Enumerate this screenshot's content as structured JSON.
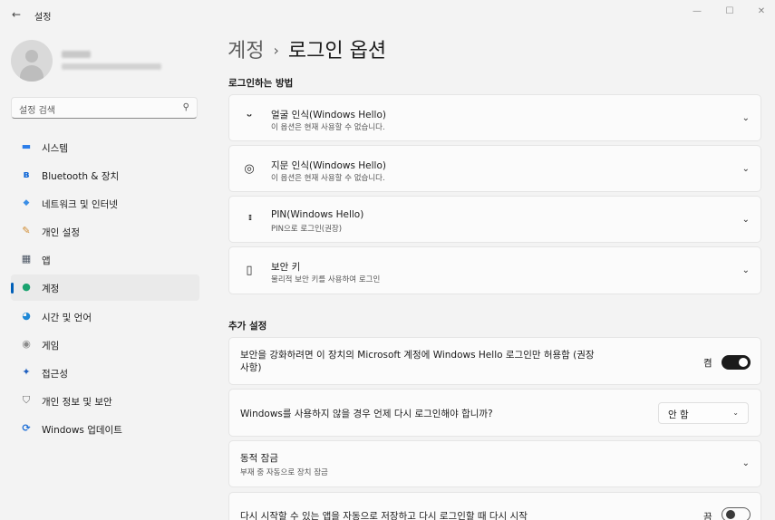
{
  "window": {
    "title": "설정",
    "back_icon": "←",
    "minimize": "—",
    "maximize": "☐",
    "close": "✕"
  },
  "sidebar": {
    "search_placeholder": "설정 검색",
    "search_icon": "⚲",
    "items": [
      {
        "label": "시스템",
        "icon": "▬",
        "icon_color": "#2b7de9"
      },
      {
        "label": "Bluetooth & 장치",
        "icon": "ʙ",
        "icon_color": "#0a64d6"
      },
      {
        "label": "네트워크 및 인터넷",
        "icon": "◆",
        "icon_color": "#3a8ee6"
      },
      {
        "label": "개인 설정",
        "icon": "✎",
        "icon_color": "#d08a2e"
      },
      {
        "label": "앱",
        "icon": "▦",
        "icon_color": "#4b5563"
      },
      {
        "label": "계정",
        "icon": "●",
        "icon_color": "#1aa36f"
      },
      {
        "label": "시간 및 언어",
        "icon": "◕",
        "icon_color": "#1e88d6"
      },
      {
        "label": "게임",
        "icon": "◉",
        "icon_color": "#8a8a8a"
      },
      {
        "label": "접근성",
        "icon": "✦",
        "icon_color": "#1f5fbf"
      },
      {
        "label": "개인 정보 및 보안",
        "icon": "⛉",
        "icon_color": "#6b6b6b"
      },
      {
        "label": "Windows 업데이트",
        "icon": "⟳",
        "icon_color": "#1f6fd6"
      }
    ]
  },
  "main": {
    "breadcrumb_parent": "계정",
    "breadcrumb_sep": "›",
    "breadcrumb_current": "로그인 옵션",
    "section1_title": "로그인하는 방법",
    "methods": [
      {
        "title": "얼굴 인식(Windows Hello)",
        "subtitle": "이 옵션은 현재 사용할 수 없습니다.",
        "icon": "ᵕ"
      },
      {
        "title": "지문 인식(Windows Hello)",
        "subtitle": "이 옵션은 현재 사용할 수 없습니다.",
        "icon": "◎"
      },
      {
        "title": "PIN(Windows Hello)",
        "subtitle": "PIN으로 로그인(권장)",
        "icon": "⁞⁞⁞"
      },
      {
        "title": "보안 키",
        "subtitle": "물리적 보안 키를 사용하여 로그인",
        "icon": "▯"
      }
    ],
    "section2_title": "추가 설정",
    "extra": {
      "hello_only_text_line1": "보안을 강화하려면 이 장치의 Microsoft 계정에 Windows Hello 로그인만 허용함 (권장",
      "hello_only_text_line2": "사항)",
      "hello_only_state": "켬",
      "hello_only_on": true,
      "signin_again_text": "Windows를 사용하지 않을 경우 언제 다시 로그인해야 합니까?",
      "signin_again_value": "안 함",
      "dynamic_lock_title": "동적 잠금",
      "dynamic_lock_subtitle": "부재 중 자동으로 장치 잠금",
      "restart_apps_text": "다시 시작할 수 있는 앱을 자동으로 저장하고 다시 로그인할 때 다시 시작",
      "restart_apps_state": "끔",
      "restart_apps_on": false
    }
  }
}
